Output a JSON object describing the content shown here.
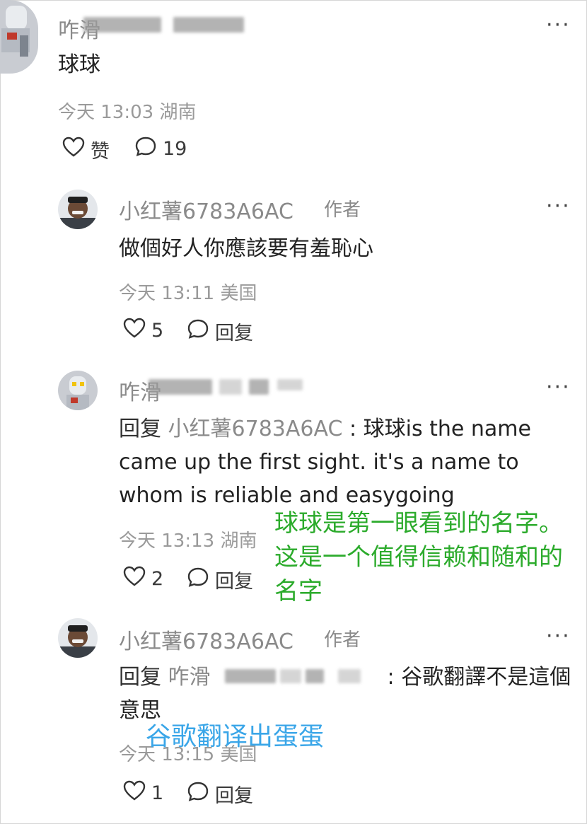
{
  "comments": [
    {
      "user": "咋滑",
      "text": "球球",
      "time": "今天 13:03",
      "location": "湖南",
      "like_label": "赞",
      "reply_count": "19"
    },
    {
      "user": "小红薯6783A6AC",
      "badge": "作者",
      "text": "做個好人你應該要有羞恥心",
      "time": "今天 13:11",
      "location": "美国",
      "likes": "5",
      "reply_label": "回复"
    },
    {
      "user": "咋滑",
      "reply_prefix": "回复",
      "reply_to": "小红薯6783A6AC",
      "text": "球球is the name came up the first sight. it's a name to whom is reliable and easygoing",
      "time": "今天 13:13",
      "location": "湖南",
      "likes": "2",
      "reply_label": "回复"
    },
    {
      "user": "小红薯6783A6AC",
      "badge": "作者",
      "reply_prefix": "回复",
      "reply_to": "咋滑",
      "text": "谷歌翻譯不是這個意思",
      "time": "今天 13:15",
      "location": "美国",
      "likes": "1",
      "reply_label": "回复"
    }
  ],
  "annotations": {
    "green": "球球是第一眼看到的名字。这是一个值得信赖和随和的名字",
    "cyan": "谷歌翻译出蛋蛋"
  },
  "more_glyph": "···",
  "colors": {
    "green": "#2cab2c",
    "cyan": "#3aa6e8",
    "meta": "#9a9a9a"
  },
  "icons": [
    "heart-icon",
    "comment-bubble-icon",
    "more-icon"
  ]
}
